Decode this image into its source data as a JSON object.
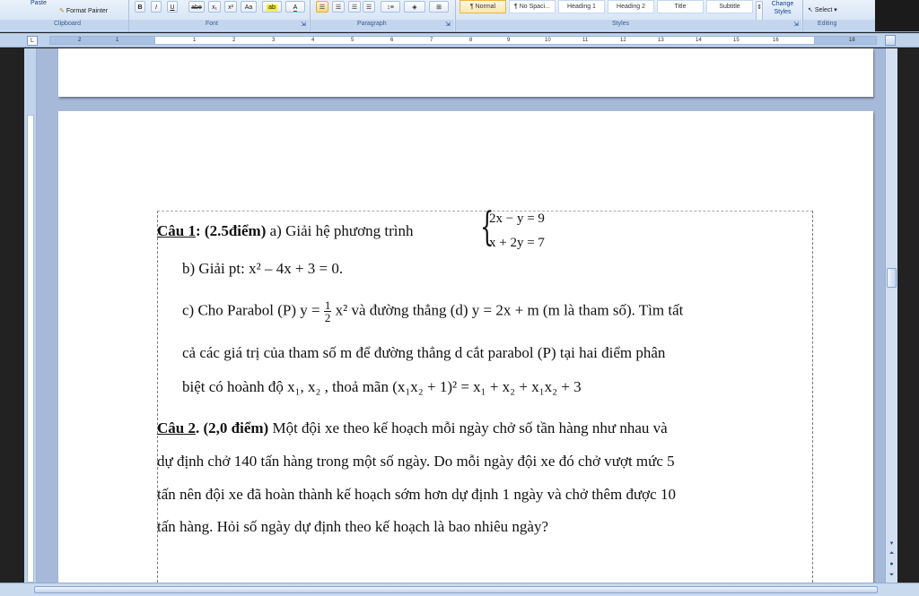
{
  "ribbon": {
    "clipboard": {
      "paste": "Paste",
      "format_painter": "Format Painter",
      "label": "Clipboard"
    },
    "font": {
      "bold": "B",
      "italic": "I",
      "underline": "U",
      "strike": "abe",
      "subscript": "x₁",
      "superscript": "x²",
      "change_case": "Aa",
      "label": "Font"
    },
    "paragraph": {
      "label": "Paragraph"
    },
    "styles": {
      "items": [
        "¶ Normal",
        "¶ No Spaci...",
        "Heading 1",
        "Heading 2",
        "Title",
        "Subtitle"
      ],
      "change_styles": "Change Styles",
      "label": "Styles"
    },
    "editing": {
      "select": "Select",
      "label": "Editing"
    }
  },
  "ruler": {
    "numbers": [
      "2",
      "1",
      "1",
      "2",
      "3",
      "4",
      "5",
      "6",
      "7",
      "8",
      "9",
      "10",
      "11",
      "12",
      "13",
      "14",
      "15",
      "16",
      "18"
    ]
  },
  "document": {
    "q1": {
      "label": "Câu 1",
      "points": "(2.5điểm)",
      "part_a": "a) Giải hệ phương trình",
      "system_eq1": "2x − y = 9",
      "system_eq2": "x + 2y = 7",
      "part_b": "b) Giải pt: x² – 4x + 3 = 0.",
      "part_c_1a": "c) Cho Parabol (P) y =",
      "frac_num": "1",
      "frac_den": "2",
      "part_c_1b": "x² và đường thẳng (d) y = 2x + m (m là tham số). Tìm tất",
      "part_c_2": "cả các giá trị của tham số m để đường thẳng d cắt parabol (P) tại hai điểm phân",
      "part_c_3": "biệt có hoành độ x₁, x₂ , thoả mãn (x₁x₂ + 1)² = x₁ + x₂ + x₁x₂ + 3"
    },
    "q2": {
      "label": "Câu 2",
      "points": "(2,0 điểm)",
      "line1": "Một đội xe theo kế hoạch mỗi ngày chở số tần hàng như nhau và",
      "line2": "dự định chở 140 tấn hàng trong một số ngày. Do mỗi ngày đội xe đó chở vượt mức 5",
      "line3": "tấn nên đội xe đã hoàn thành kế hoạch sớm hơn dự định 1 ngày và chở thêm được 10",
      "line4": "tấn hàng. Hỏi số ngày dự định theo kế hoạch là bao nhiêu ngày?"
    }
  }
}
